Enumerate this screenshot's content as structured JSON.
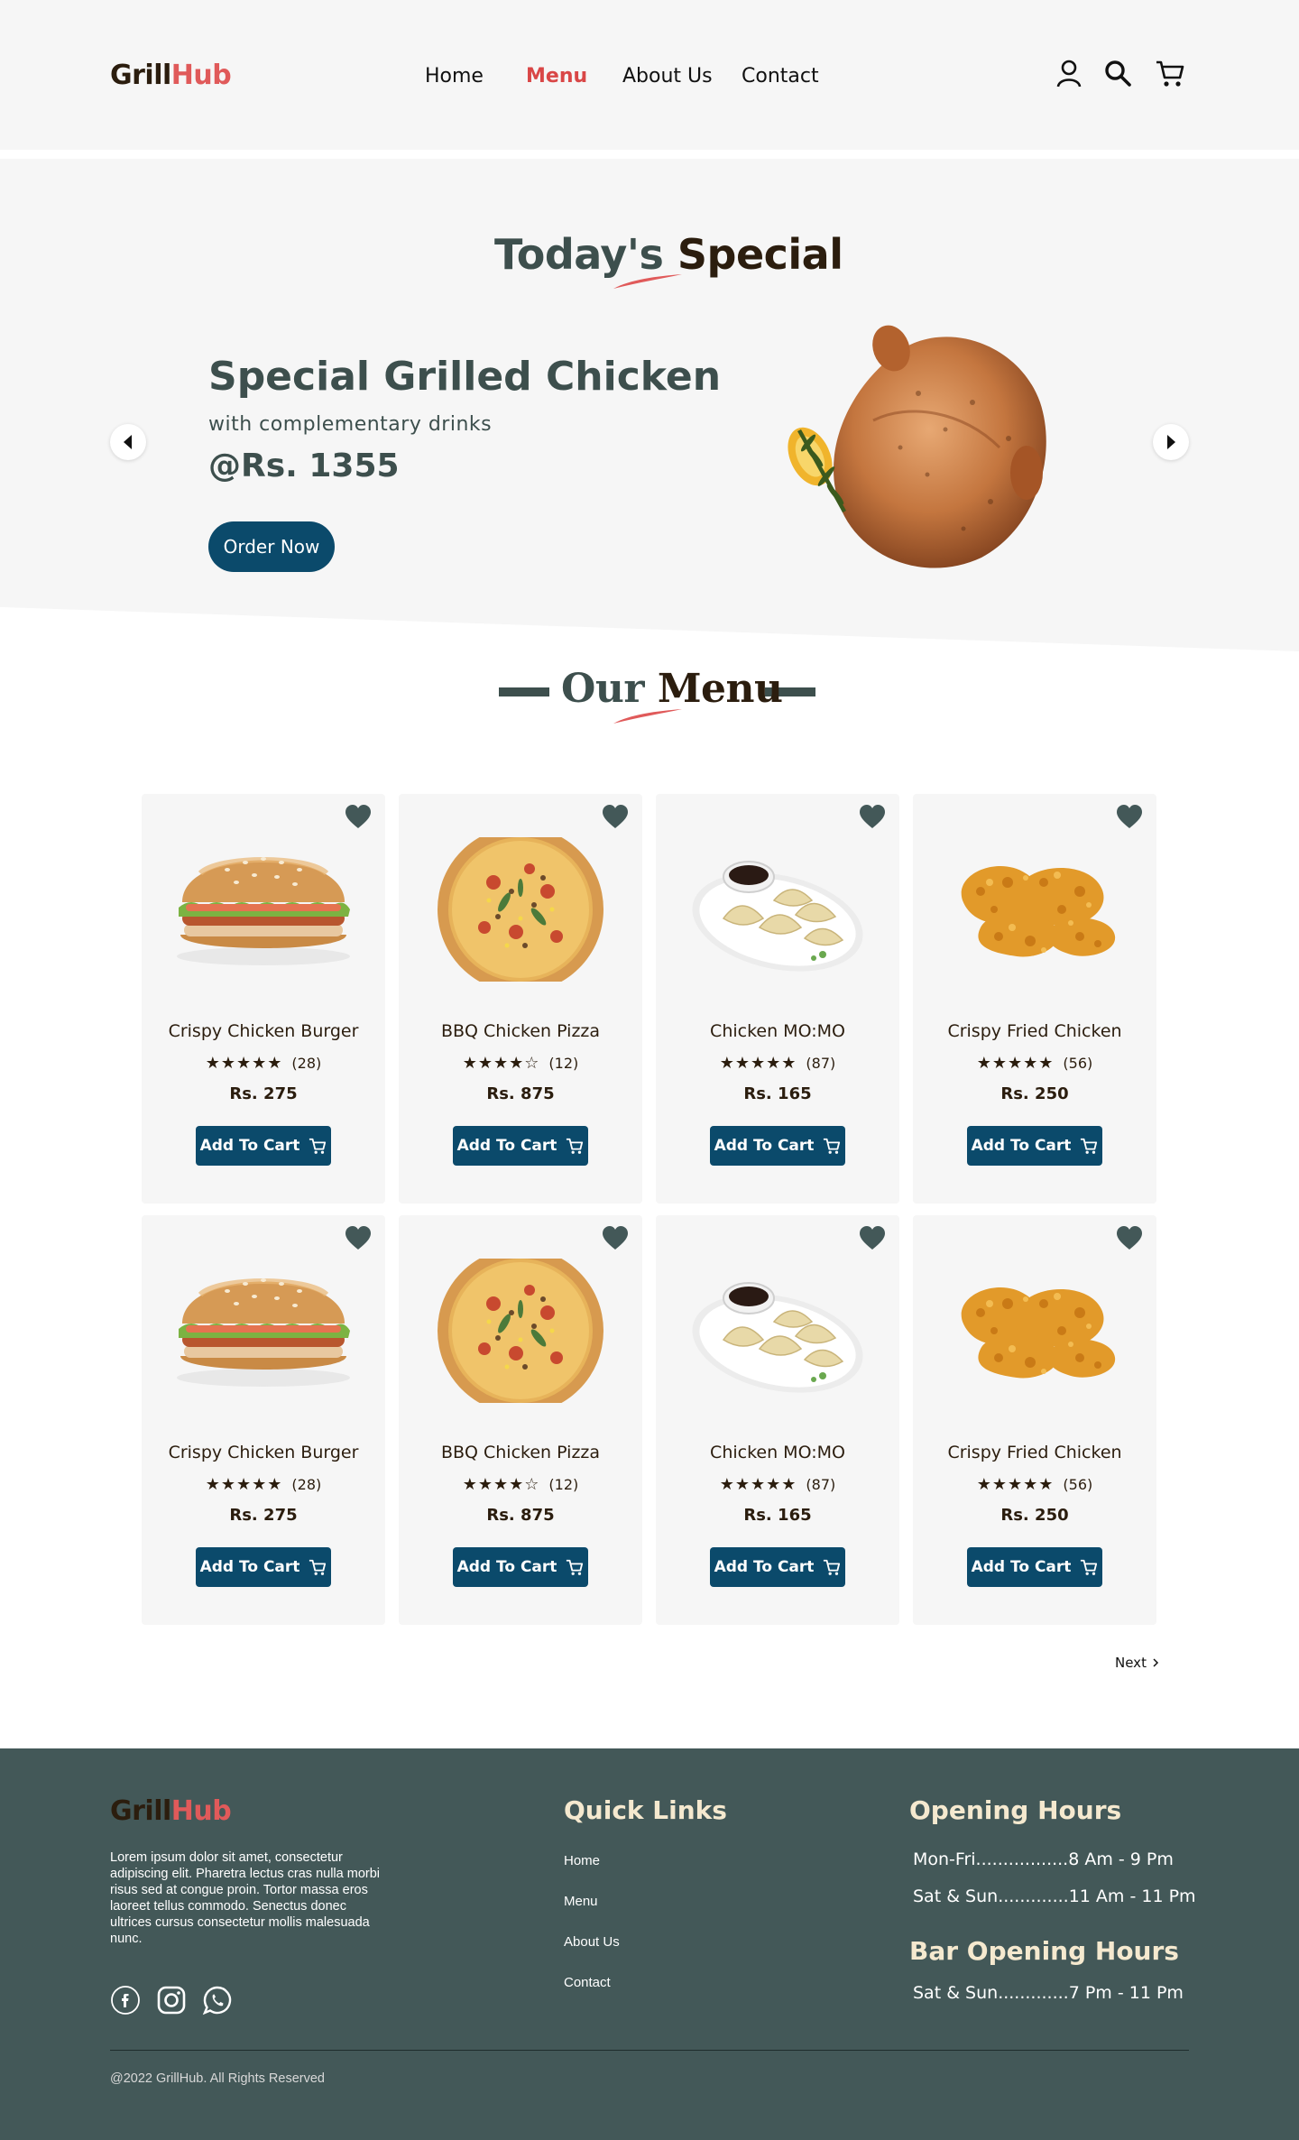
{
  "header": {
    "logo": {
      "part1": "Grill",
      "part2": "Hub"
    },
    "nav": [
      {
        "label": "Home"
      },
      {
        "label": "Menu",
        "active": true
      },
      {
        "label": "About Us"
      },
      {
        "label": "Contact"
      }
    ],
    "icons": [
      "user-icon",
      "search-icon",
      "cart-icon"
    ]
  },
  "hero": {
    "title_part1": "Today's",
    "title_part2": "Special",
    "dish": "Special Grilled Chicken",
    "subtitle": "with complementary drinks",
    "price": "@Rs. 1355",
    "order_label": "Order Now"
  },
  "menu": {
    "title_part1": "Our",
    "title_part2": "Menu",
    "items": [
      {
        "name": "Crispy Chicken Burger",
        "stars": "★★★★★",
        "reviews": "(28)",
        "price": "Rs. 275",
        "cart_label": "Add To Cart",
        "image": "burger"
      },
      {
        "name": "BBQ Chicken Pizza",
        "stars": "★★★★☆",
        "reviews": "(12)",
        "price": "Rs. 875",
        "cart_label": "Add To Cart",
        "image": "pizza"
      },
      {
        "name": "Chicken MO:MO",
        "stars": "★★★★★",
        "reviews": "(87)",
        "price": "Rs. 165",
        "cart_label": "Add To Cart",
        "image": "momo"
      },
      {
        "name": "Crispy Fried Chicken",
        "stars": "★★★★★",
        "reviews": "(56)",
        "price": "Rs. 250",
        "cart_label": "Add To Cart",
        "image": "fried-chicken"
      },
      {
        "name": "Crispy Chicken Burger",
        "stars": "★★★★★",
        "reviews": "(28)",
        "price": "Rs. 275",
        "cart_label": "Add To Cart",
        "image": "burger"
      },
      {
        "name": "BBQ Chicken Pizza",
        "stars": "★★★★☆",
        "reviews": "(12)",
        "price": "Rs. 875",
        "cart_label": "Add To Cart",
        "image": "pizza"
      },
      {
        "name": "Chicken MO:MO",
        "stars": "★★★★★",
        "reviews": "(87)",
        "price": "Rs. 165",
        "cart_label": "Add To Cart",
        "image": "momo"
      },
      {
        "name": "Crispy Fried Chicken",
        "stars": "★★★★★",
        "reviews": "(56)",
        "price": "Rs. 250",
        "cart_label": "Add To Cart",
        "image": "fried-chicken"
      }
    ],
    "next_label": "Next"
  },
  "footer": {
    "logo": {
      "part1": "Grill",
      "part2": "Hub"
    },
    "description": "Lorem ipsum dolor sit amet, consectetur adipiscing elit. Pharetra lectus cras nulla morbi risus sed at congue proin. Tortor massa eros laoreet tellus commodo. Senectus donec ultrices cursus consectetur mollis malesuada nunc.",
    "social": [
      "facebook-icon",
      "instagram-icon",
      "whatsapp-icon"
    ],
    "quick_links_title": "Quick Links",
    "quick_links": [
      "Home",
      "Menu",
      "About Us",
      "Contact"
    ],
    "opening_title": "Opening Hours",
    "opening": [
      "Mon-Fri.................8 Am - 9 Pm",
      "Sat & Sun.............11 Am - 11 Pm"
    ],
    "bar_title": "Bar Opening Hours",
    "bar": [
      "Sat & Sun.............7 Pm - 11 Pm"
    ],
    "copyright": "@2022 GrillHub. All Rights Reserved"
  },
  "colors": {
    "accent": "#e05a5a",
    "primary": "#0b4a6b",
    "slate": "#3d4f4d",
    "footer": "#435858",
    "cream": "#f5e9cf"
  }
}
